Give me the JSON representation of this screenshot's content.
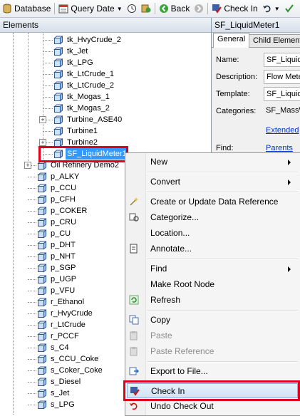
{
  "toolbar": {
    "database_label": "Database",
    "query_date_label": "Query Date",
    "back_label": "Back",
    "check_in_label": "Check In"
  },
  "left_pane": {
    "header": "Elements",
    "tree_items": [
      "tk_HvyCrude_2",
      "tk_Jet",
      "tk_LPG",
      "tk_LtCrude_1",
      "tk_LtCrude_2",
      "tk_Mogas_1",
      "tk_Mogas_2",
      "Turbine_ASE40",
      "Turbine1",
      "Turbine2",
      "SF_LiquidMeter1",
      "Oil Refinery Demo2",
      "p_ALKY",
      "p_CCU",
      "p_CFH",
      "p_COKER",
      "p_CRU",
      "p_CU",
      "p_DHT",
      "p_NHT",
      "p_SGP",
      "p_UGP",
      "p_VFU",
      "r_Ethanol",
      "r_HvyCrude",
      "r_LtCrude",
      "r_PCCF",
      "s_C4",
      "s_CCU_Coke",
      "s_Coker_Coke",
      "s_Diesel",
      "s_Jet",
      "s_LPG"
    ]
  },
  "right_pane": {
    "title": "SF_LiquidMeter1",
    "tabs": [
      "General",
      "Child Elements"
    ],
    "name_label": "Name:",
    "name_value": "SF_LiquidM",
    "description_label": "Description:",
    "description_value": "Flow Mete",
    "template_label": "Template:",
    "template_value": "SF_LiquidM",
    "categories_label": "Categories:",
    "categories_value": "SF_MassW",
    "extended_link": "Extended",
    "find_label": "Find:",
    "parents_link": "Parents"
  },
  "context_menu": {
    "new": "New",
    "convert": "Convert",
    "create_update_ref": "Create or Update Data Reference",
    "categorize": "Categorize...",
    "location": "Location...",
    "annotate": "Annotate...",
    "find": "Find",
    "make_root": "Make Root Node",
    "refresh": "Refresh",
    "copy": "Copy",
    "paste": "Paste",
    "paste_reference": "Paste Reference",
    "export": "Export to File...",
    "check_in": "Check In",
    "undo_check_out": "Undo Check Out"
  },
  "colors": {
    "selection": "#3399ff",
    "highlight_box": "#e0001b",
    "link": "#0033cc"
  }
}
